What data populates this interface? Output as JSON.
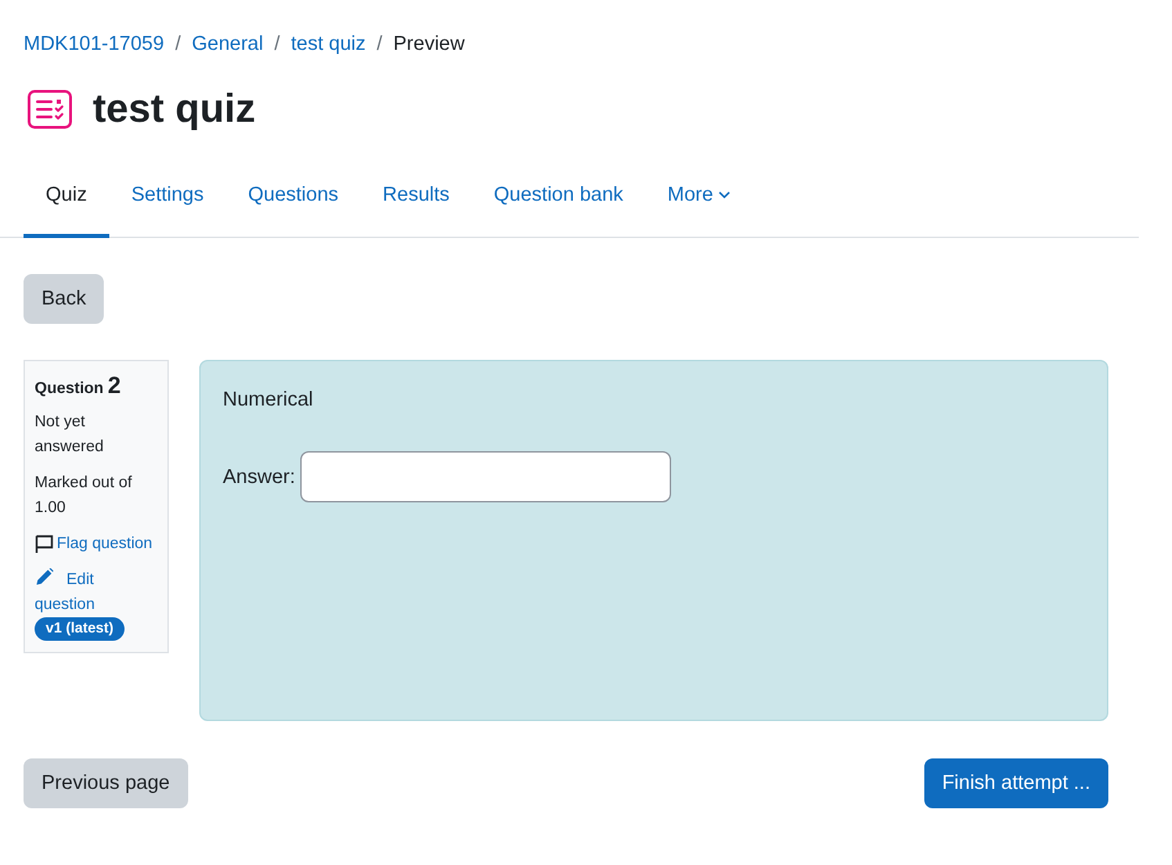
{
  "breadcrumb": [
    {
      "kind": "link",
      "label": "MDK101-17059"
    },
    {
      "kind": "separator",
      "label": "/"
    },
    {
      "kind": "link",
      "label": "General"
    },
    {
      "kind": "separator",
      "label": "/"
    },
    {
      "kind": "link",
      "label": "test quiz"
    },
    {
      "kind": "separator",
      "label": "/"
    },
    {
      "kind": "current",
      "label": "Preview"
    }
  ],
  "page": {
    "title": "test quiz"
  },
  "tabs": [
    {
      "kind": "link",
      "label": "Quiz",
      "selected": true
    },
    {
      "kind": "link",
      "label": "Settings",
      "selected": false
    },
    {
      "kind": "link",
      "label": "Questions",
      "selected": false
    },
    {
      "kind": "link",
      "label": "Results",
      "selected": false
    },
    {
      "kind": "link",
      "label": "Question bank",
      "selected": false
    },
    {
      "kind": "dropdown",
      "label": "More",
      "selected": false
    }
  ],
  "back_button": "Back",
  "question_info": {
    "heading": "Question",
    "number": "2",
    "state": "Not yet answered",
    "marks": "Marked out of 1.00",
    "flag_link": "Flag question",
    "flagged": false,
    "edit_link": "Edit question",
    "version_badge": "v1 (latest)"
  },
  "question": {
    "type_label": "Numerical",
    "answer_label": "Answer:"
  },
  "navigation": {
    "previous": "Previous page",
    "finish": "Finish attempt ..."
  }
}
